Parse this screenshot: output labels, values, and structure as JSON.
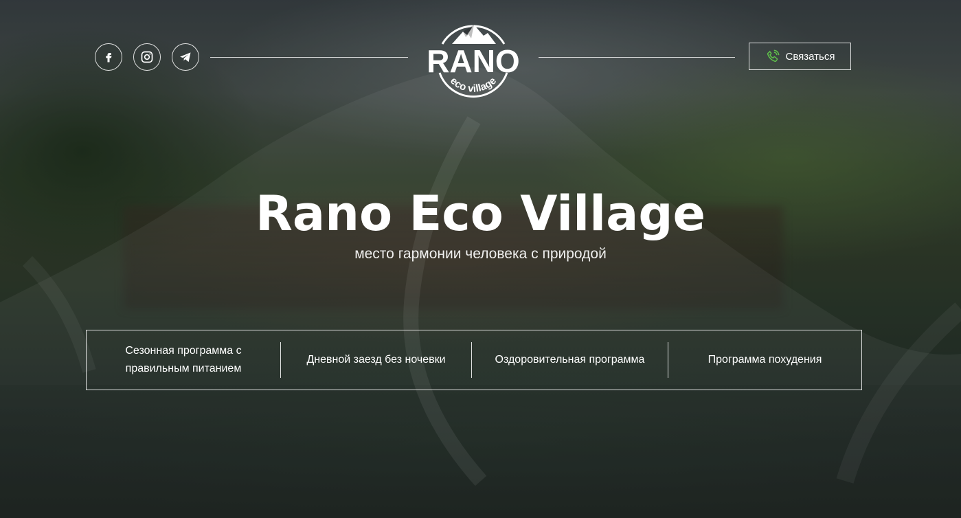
{
  "header": {
    "social": [
      {
        "name": "facebook-icon"
      },
      {
        "name": "instagram-icon"
      },
      {
        "name": "telegram-icon"
      }
    ],
    "logo": {
      "title": "RANO",
      "subtitle": "eco village"
    },
    "contact": {
      "label": "Связаться",
      "icon": "phone-icon",
      "icon_color": "#5fc24a"
    }
  },
  "hero": {
    "title": "Rano Eco Village",
    "subtitle": "место гармонии человека с природой"
  },
  "programs": [
    {
      "label": "Сезонная программа с правильным питанием"
    },
    {
      "label": "Дневной заезд без ночевки"
    },
    {
      "label": "Оздоровительная программа"
    },
    {
      "label": "Программа похудения"
    }
  ]
}
